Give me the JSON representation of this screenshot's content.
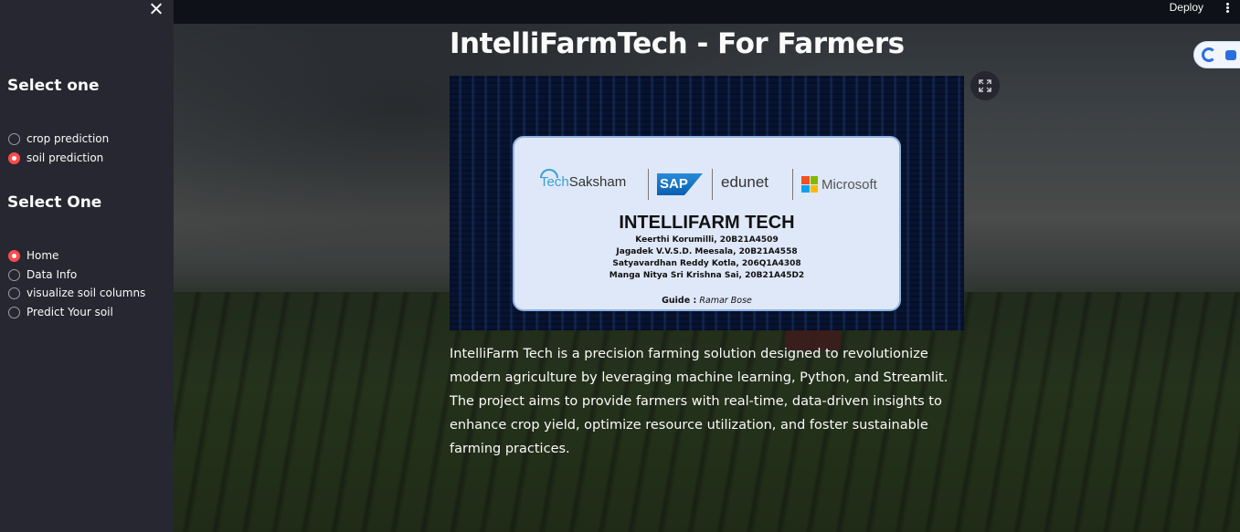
{
  "header": {
    "deploy_label": "Deploy"
  },
  "sidebar": {
    "section1": {
      "heading": "Select one",
      "options": [
        {
          "label": "crop prediction",
          "selected": false
        },
        {
          "label": "soil prediction",
          "selected": true
        }
      ]
    },
    "section2": {
      "heading": "Select One",
      "options": [
        {
          "label": "Home",
          "selected": true
        },
        {
          "label": "Data Info",
          "selected": false
        },
        {
          "label": "visualize soil columns",
          "selected": false
        },
        {
          "label": "Predict Your soil",
          "selected": false
        }
      ]
    }
  },
  "main": {
    "title": "IntelliFarmTech - For Farmers",
    "banner": {
      "logos": {
        "techsaksham_prefix": "Tech",
        "techsaksham_suffix": "Saksham",
        "sap": "SAP",
        "edunet": "edunet",
        "microsoft": "Microsoft"
      },
      "title": "INTELLIFARM TECH",
      "members": [
        "Keerthi Korumilli, 20B21A4509",
        "Jagadek V.V.S.D. Meesala, 20B21A4558",
        "Satyavardhan Reddy Kotla, 206Q1A4308",
        "Manga Nitya Sri Krishna Sai, 20B21A45D2"
      ],
      "guide_label": "Guide :",
      "guide_name": "Ramar Bose"
    },
    "description": "IntelliFarm Tech is a precision farming solution designed to revolutionize modern agriculture by leveraging machine learning, Python, and Streamlit. The project aims to provide farmers with real-time, data-driven insights to enhance crop yield, optimize resource utilization, and foster sustainable farming practices."
  },
  "colors": {
    "accent": "#ff4b4b",
    "sidebar_bg": "#262730",
    "header_bg": "#0e1117"
  }
}
